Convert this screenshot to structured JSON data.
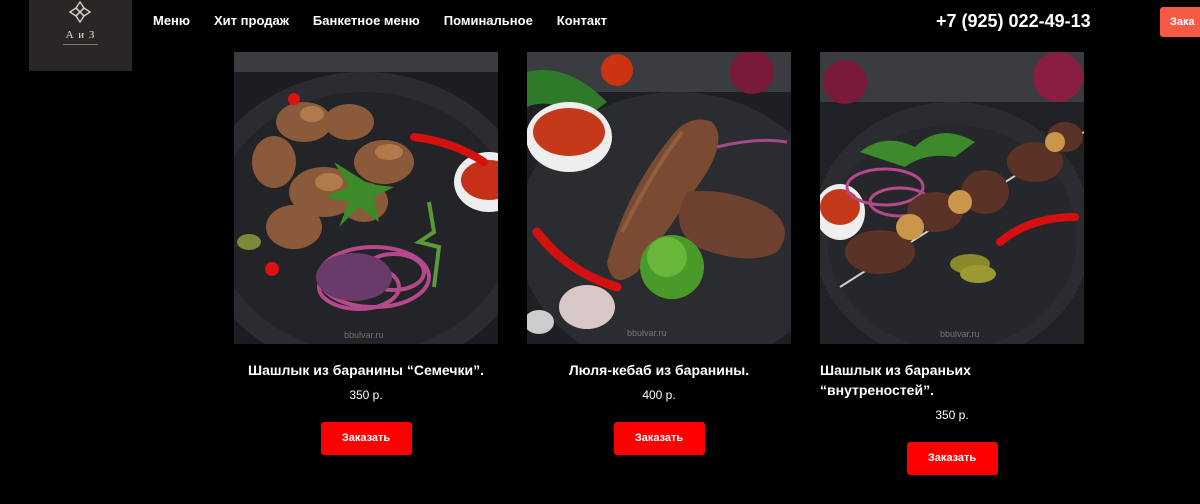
{
  "logo": {
    "brand": "А и З",
    "icon": "ornament-icon"
  },
  "nav": [
    {
      "label": "Меню"
    },
    {
      "label": "Хит продаж"
    },
    {
      "label": "Банкетное меню"
    },
    {
      "label": "Поминальное"
    },
    {
      "label": "Контакт"
    }
  ],
  "header": {
    "phone": "+7 (925) 022-49-13",
    "order_label": "Зака"
  },
  "watermark": "bbulvar.ru",
  "products": [
    {
      "title": "Шашлык из баранины “Семечки”.",
      "price": "350 р.",
      "button": "Заказать"
    },
    {
      "title": "Люля-кебаб из баранины.",
      "price": "400 р.",
      "button": "Заказать"
    },
    {
      "title": "Шашлык из бараньих “внутреностей”.",
      "price": "350 р.",
      "button": "Заказать"
    }
  ],
  "colors": {
    "accent": "#ff0000",
    "header_button": "#f45a44",
    "background": "#000000"
  }
}
